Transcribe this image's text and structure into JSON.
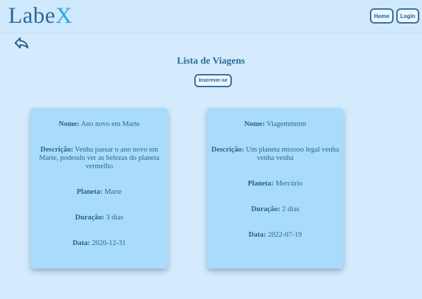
{
  "header": {
    "logo_main": "Labe",
    "logo_accent": "X",
    "nav": {
      "home_label": "Home",
      "login_label": "Login"
    }
  },
  "main": {
    "back_icon": "back-arrow-icon",
    "title": "Lista de Viagens",
    "subscribe_label": "Inscrever-se"
  },
  "labels": {
    "name": "Nome:",
    "description": "Descrição:",
    "planet": "Planeta:",
    "duration": "Duração:",
    "date": "Data:"
  },
  "trips": [
    {
      "name": "Ano novo em Marte",
      "description": "Venha passar o ano novo em Marte, podendo ver as belezas do planeta vermelho",
      "planet": "Marte",
      "duration": "3 dias",
      "date": "2020-12-31"
    },
    {
      "name": "Viagemmmm",
      "description": "Um planeta mtoooo legal venha venha venha",
      "planet": "Mercúrio",
      "duration": "2 dias",
      "date": "2022-07-19"
    }
  ],
  "colors": {
    "background": "#d3ebfc",
    "card": "#a9dbfa",
    "text": "#2d5f86",
    "logo_accent": "#29a7e6"
  }
}
